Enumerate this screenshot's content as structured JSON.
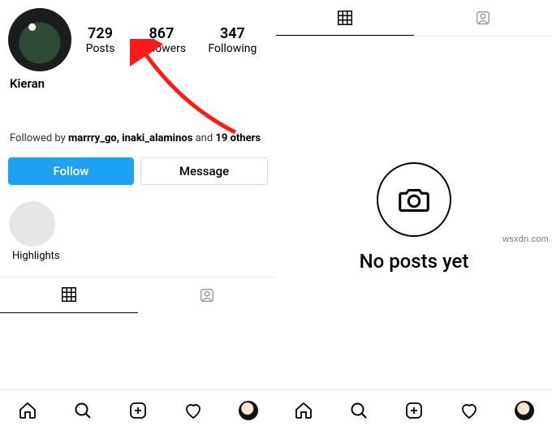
{
  "profile": {
    "display_name": "Kieran",
    "stats": {
      "posts": {
        "count": "729",
        "label": "Posts"
      },
      "followers": {
        "count": "867",
        "label": "Followers"
      },
      "following": {
        "count": "347",
        "label": "Following"
      }
    },
    "followed_by_prefix": "Followed by ",
    "followed_by_names": "marrry_go, inaki_alaminos",
    "followed_by_mid": " and ",
    "followed_by_others": "19 others",
    "buttons": {
      "follow": "Follow",
      "message": "Message"
    },
    "highlights_label": "Highlights"
  },
  "empty_state": {
    "text": "No posts yet"
  },
  "watermark": "wsxdn.com"
}
